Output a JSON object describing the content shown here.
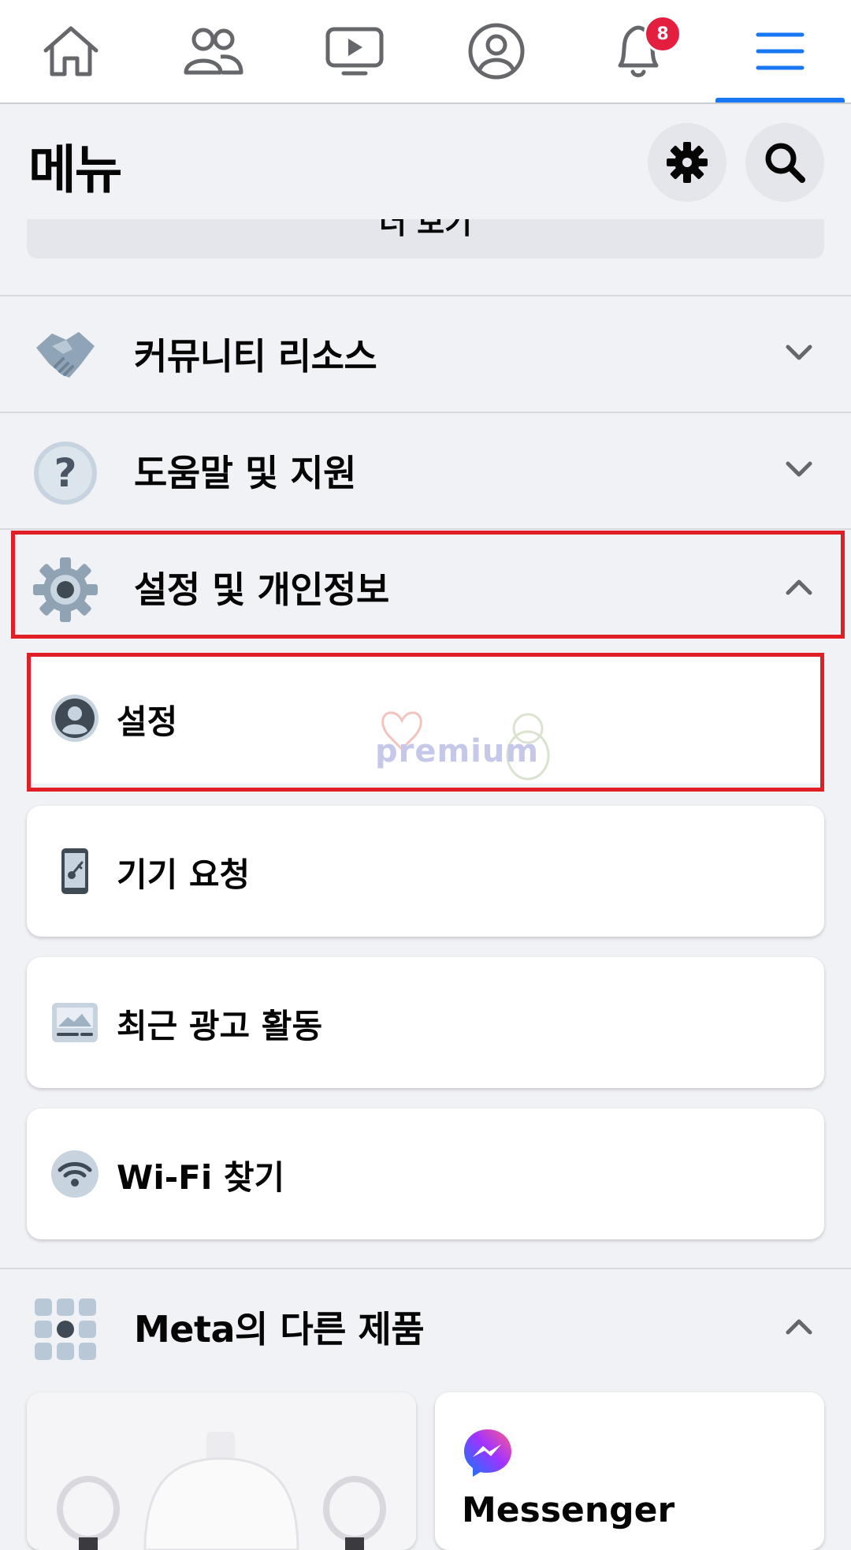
{
  "nav": {
    "items": [
      "home-icon",
      "friends-icon",
      "watch-icon",
      "profile-icon",
      "notifications-icon",
      "menu-icon"
    ],
    "notification_count": "8",
    "active": "menu"
  },
  "header": {
    "title": "메뉴"
  },
  "see_more": {
    "label": "더 보기"
  },
  "sections": {
    "community": {
      "label": "커뮤니티 리소스"
    },
    "help": {
      "label": "도움말 및 지원"
    },
    "settings_privacy": {
      "label": "설정 및 개인정보"
    },
    "meta": {
      "label": "Meta의 다른 제품"
    }
  },
  "settings_items": [
    {
      "label": "설정"
    },
    {
      "label": "기기 요청"
    },
    {
      "label": "최근 광고 활동"
    },
    {
      "label": "Wi-Fi 찾기"
    }
  ],
  "products": {
    "messenger": {
      "label": "Messenger"
    }
  },
  "watermark": {
    "text": "premium"
  },
  "colors": {
    "accent": "#1877f2",
    "highlight": "#e01e26",
    "badge": "#e41e3f",
    "bg": "#f0f2f5"
  }
}
